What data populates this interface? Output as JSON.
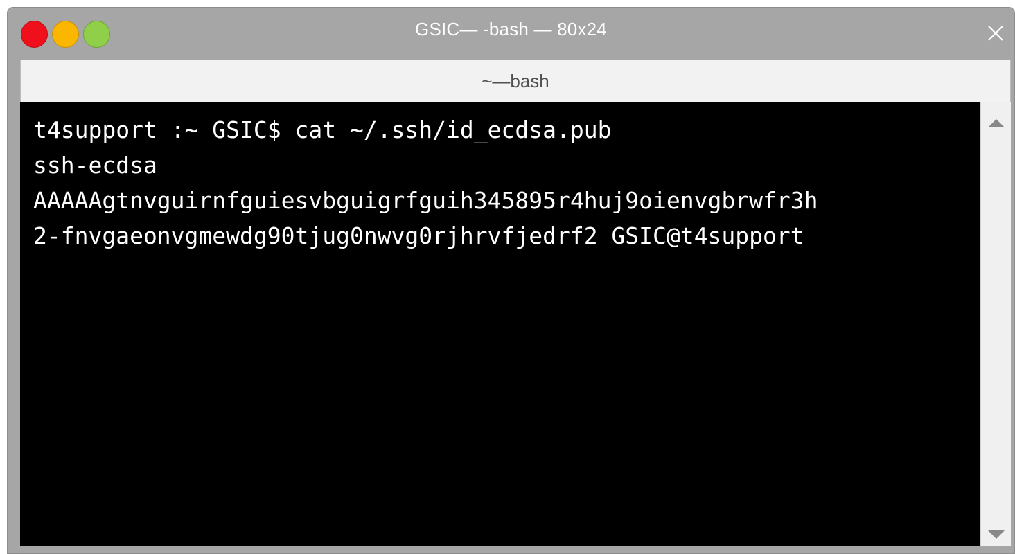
{
  "window": {
    "title": "GSIC— -bash — 80x24",
    "controls": {
      "close_color": "#f0101c",
      "minimize_color": "#fbb700",
      "zoom_color": "#8fcf4a"
    },
    "close_icon": "close-x-icon"
  },
  "tab": {
    "label": "~—bash"
  },
  "terminal": {
    "lines": [
      "t4support :~ GSIC$ cat ~/.ssh/id_ecdsa.pub",
      "ssh-ecdsa",
      "AAAAAgtnvguirnfguiesvbguigrfguih345895r4huj9oienvgbrwfr3h",
      "2-fnvgaeonvgmewdg90tjug0nwvg0rjhrvfjedrf2 GSIC@t4support"
    ],
    "background": "#000000",
    "foreground": "#ffffff"
  },
  "scrollbar": {
    "up_icon": "scroll-up-arrow-icon",
    "down_icon": "scroll-down-arrow-icon"
  }
}
